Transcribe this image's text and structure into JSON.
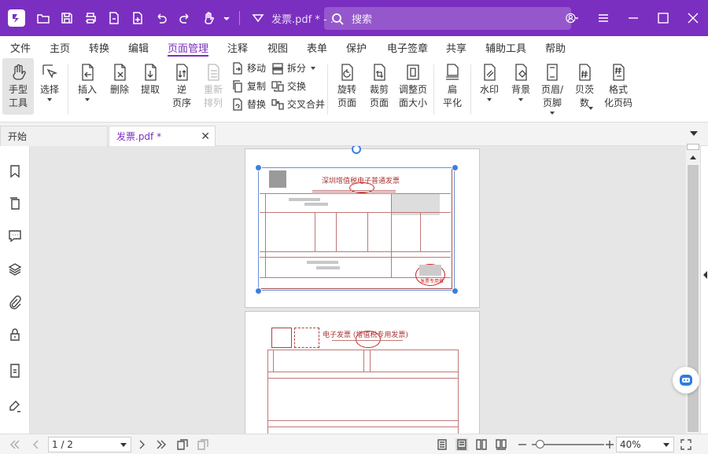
{
  "titlebar": {
    "doc_title": "发票.pdf * - ...",
    "search_placeholder": "搜索",
    "accent": "#7b2fc0"
  },
  "menu": [
    "文件",
    "主页",
    "转换",
    "编辑",
    "页面管理",
    "注释",
    "视图",
    "表单",
    "保护",
    "电子签章",
    "共享",
    "辅助工具",
    "帮助"
  ],
  "menu_active": "页面管理",
  "ribbon": {
    "hand": "手型\n工具",
    "select": "选择",
    "insert": "插入",
    "delete": "删除",
    "extract": "提取",
    "reverse": "逆\n页序",
    "reorder": "重新\n排列",
    "move": "移动",
    "split": "拆分",
    "copy": "复制",
    "swap": "交换",
    "replace": "替换",
    "cross_merge": "交叉合并",
    "rotate": "旋转\n页面",
    "crop": "裁剪\n页面",
    "resize": "调整页\n面大小",
    "flatten": "扁\n平化",
    "watermark": "水印",
    "background": "背景",
    "header_footer": "页眉/\n页脚",
    "bates": "贝茨\n数",
    "format_page_num": "格式\n化页码"
  },
  "tabs": {
    "start": "开始",
    "doc": "发票.pdf *"
  },
  "invoice": {
    "title1": "深圳增值税电子普通发票",
    "title2": "电子发票 (增值税专用发票)",
    "stamp": "发票专用章"
  },
  "status": {
    "page": "1 / 2",
    "zoom": "40%"
  }
}
